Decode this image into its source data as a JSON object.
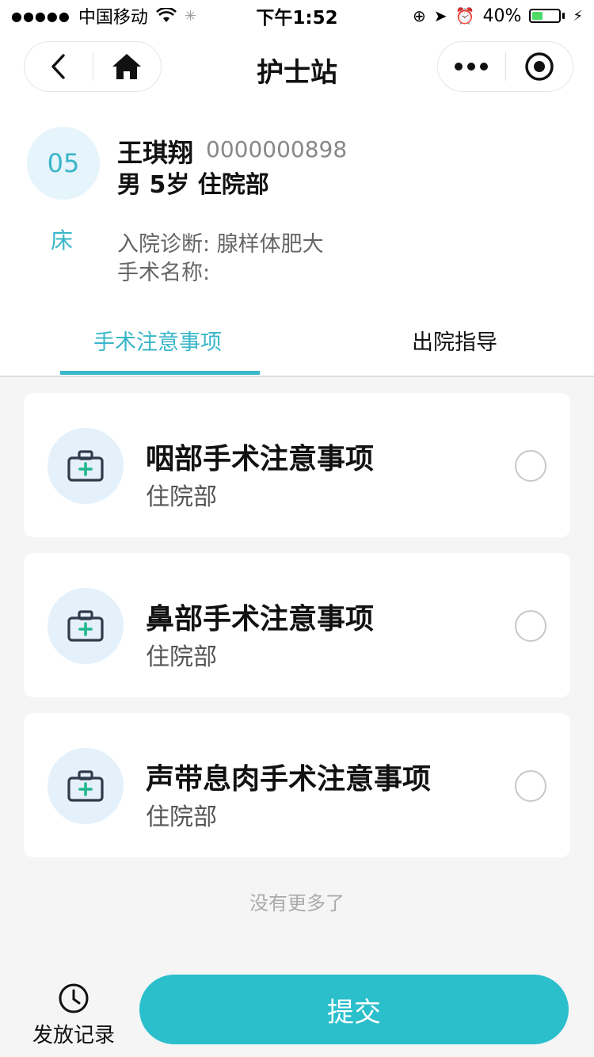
{
  "status_bar": {
    "carrier": "中国移动",
    "time": "下午1:52",
    "battery": "40%",
    "battery_level": 0.4
  },
  "nav": {
    "title": "护士站"
  },
  "patient": {
    "bed_no": "05",
    "bed_label": "床",
    "name": "王琪翔",
    "id": "0000000898",
    "info": "男 5岁 住院部",
    "diagnosis": "入院诊断: 腺样体肥大",
    "surgery": "手术名称:"
  },
  "tabs": [
    {
      "label": "手术注意事项",
      "active": true
    },
    {
      "label": "出院指导",
      "active": false
    }
  ],
  "items": [
    {
      "title": "咽部手术注意事项",
      "dept": "住院部",
      "checked": false
    },
    {
      "title": "鼻部手术注意事项",
      "dept": "住院部",
      "checked": false
    },
    {
      "title": "声带息肉手术注意事项",
      "dept": "住院部",
      "checked": false
    }
  ],
  "no_more": "没有更多了",
  "bottom": {
    "records_label": "发放记录",
    "submit_label": "提交"
  },
  "colors": {
    "accent": "#39b6c9",
    "button": "#2bbfcc",
    "battery_green": "#4cd964"
  },
  "icons": [
    "back-icon",
    "home-icon",
    "more-icon",
    "target-icon",
    "medical-kit-icon",
    "clock-icon"
  ]
}
